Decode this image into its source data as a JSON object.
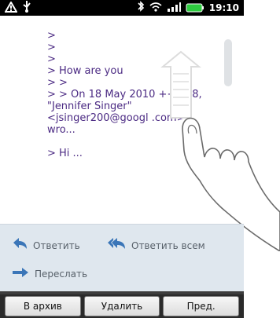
{
  "statusbar": {
    "time": "19:10",
    "icons": [
      "warning-icon",
      "usb-icon",
      "bluetooth-icon",
      "wifi-icon",
      "signal-icon",
      "battery-icon"
    ],
    "battery_color": "#2ecc40"
  },
  "mail": {
    "lines": [
      ">",
      ">",
      ">",
      "> How are you",
      "> >",
      "> > On 18 May 2010 ++3:38,",
      "\"Jennifer Singer\"",
      "<jsinger200@googl .com>",
      "wro...",
      "",
      "> Hi ..."
    ]
  },
  "actions": {
    "reply_label": "Ответить",
    "reply_all_label": "Ответить всем",
    "forward_label": "Переслать",
    "icon_color": "#3b76b8"
  },
  "bottombar": {
    "archive_label": "В архив",
    "delete_label": "Удалить",
    "prev_label": "Пред."
  }
}
